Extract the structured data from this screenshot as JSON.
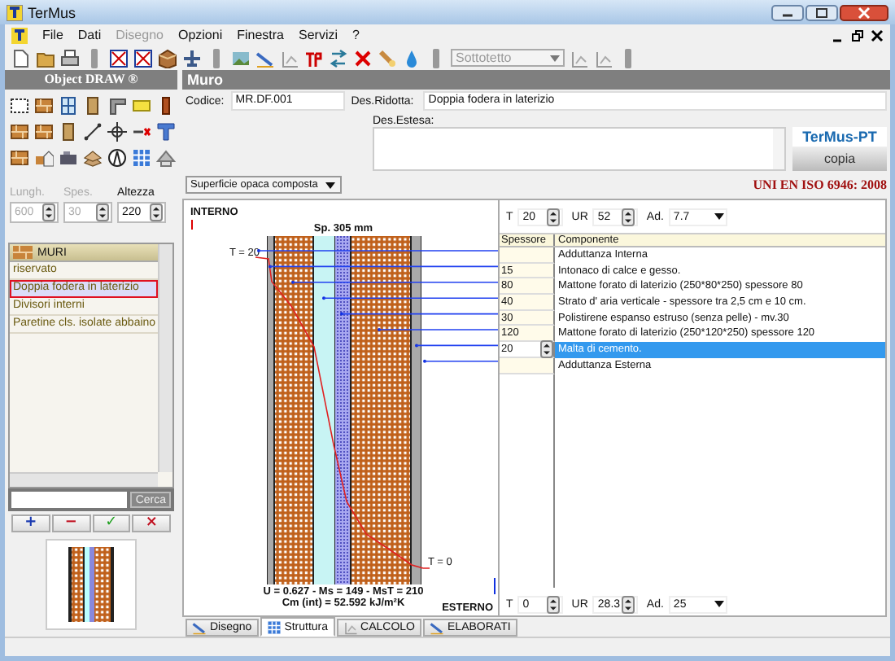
{
  "window": {
    "title": "TerMus"
  },
  "menu": [
    {
      "label": "File",
      "disabled": false
    },
    {
      "label": "Dati",
      "disabled": false
    },
    {
      "label": "Disegno",
      "disabled": true
    },
    {
      "label": "Opzioni",
      "disabled": false
    },
    {
      "label": "Finestra",
      "disabled": false
    },
    {
      "label": "Servizi",
      "disabled": false
    },
    {
      "label": "?",
      "disabled": false
    }
  ],
  "toolbar": {
    "level_select": {
      "value": "Sottotetto",
      "disabled": true
    }
  },
  "object_draw": {
    "title": "Object DRAW ®",
    "fields": [
      {
        "label": "Lungh.",
        "value": "600",
        "disabled": true
      },
      {
        "label": "Spes.",
        "value": "30",
        "disabled": true
      },
      {
        "label": "Altezza",
        "value": "220",
        "disabled": false
      }
    ]
  },
  "library": {
    "category": "MURI",
    "items": [
      {
        "label": "riservato",
        "selected": false
      },
      {
        "label": "Doppia fodera in laterizio",
        "selected": true
      },
      {
        "label": "Divisori interni",
        "selected": false
      },
      {
        "label": "Paretine cls. isolate abbaino",
        "selected": false
      }
    ],
    "search_button": "Cerca",
    "buttons": [
      {
        "kind": "add",
        "label": "+"
      },
      {
        "kind": "remove",
        "label": "−"
      },
      {
        "kind": "confirm",
        "label": "✓"
      },
      {
        "kind": "cancel",
        "label": "×"
      }
    ]
  },
  "panel": {
    "title": "Muro",
    "code_label": "Codice:",
    "code": "MR.DF.001",
    "short_label": "Des.Ridotta:",
    "short": "Doppia fodera in laterizio",
    "long_label": "Des.Estesa:",
    "brand": "TerMus-PT",
    "copy_button": "copia",
    "surface_type": "Superficie opaca composta",
    "standard": "UNI EN ISO 6946: 2008"
  },
  "drawing": {
    "inside": "INTERNO",
    "thickness": "Sp. 305 mm",
    "t_inside": "T = 20",
    "t_outside": "T = 0",
    "summary_1": "U = 0.627 - Ms = 149 - MsT = 210",
    "summary_2": "Cm (int) = 52.592 kJ/m²K",
    "outside": "ESTERNO"
  },
  "conditions_inside": [
    {
      "kind": "spin",
      "label": "T",
      "value": "20"
    },
    {
      "kind": "spin",
      "label": "UR",
      "value": "52"
    },
    {
      "kind": "select",
      "label": "Ad.",
      "value": "7.7"
    }
  ],
  "table": {
    "columns": [
      "Spessore",
      "Componente"
    ],
    "rows": [
      {
        "thickness": "",
        "component": "Adduttanza Interna",
        "selected": false
      },
      {
        "thickness": "15",
        "component": "Intonaco di calce e gesso.",
        "selected": false
      },
      {
        "thickness": "80",
        "component": "Mattone forato di laterizio (250*80*250) spessore 80",
        "selected": false
      },
      {
        "thickness": "40",
        "component": "Strato d' aria verticale - spessore tra 2,5 cm e 10 cm.",
        "selected": false
      },
      {
        "thickness": "30",
        "component": "Polistirene espanso estruso (senza pelle) - mv.30",
        "selected": false
      },
      {
        "thickness": "120",
        "component": "Mattone forato di laterizio (250*120*250) spessore 120",
        "selected": false
      },
      {
        "thickness": "20",
        "component": "Malta di cemento.",
        "selected": true
      },
      {
        "thickness": "",
        "component": "Adduttanza Esterna",
        "selected": false
      }
    ]
  },
  "conditions_outside": [
    {
      "kind": "spin",
      "label": "T",
      "value": "0"
    },
    {
      "kind": "spin",
      "label": "UR",
      "value": "28.3"
    },
    {
      "kind": "select",
      "label": "Ad.",
      "value": "25"
    }
  ],
  "tabs": [
    {
      "label": "Disegno",
      "selected": false
    },
    {
      "label": "Struttura",
      "selected": true
    },
    {
      "label": "CALCOLO",
      "selected": false
    },
    {
      "label": "ELABORATI",
      "selected": false
    }
  ]
}
